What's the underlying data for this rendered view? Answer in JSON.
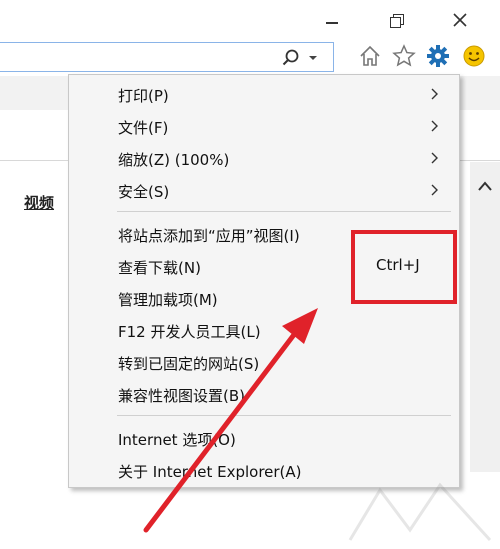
{
  "menu": {
    "items": [
      {
        "label": "打印(P)",
        "submenu": true
      },
      {
        "label": "文件(F)",
        "submenu": true
      },
      {
        "label": "缩放(Z) (100%)",
        "submenu": true
      },
      {
        "label": "安全(S)",
        "submenu": true
      },
      {
        "label": "将站点添加到“应用”视图(I)",
        "submenu": false
      },
      {
        "label": "查看下载(N)",
        "submenu": false,
        "shortcut": "Ctrl+J"
      },
      {
        "label": "管理加载项(M)",
        "submenu": false
      },
      {
        "label": "F12 开发人员工具(L)",
        "submenu": false
      },
      {
        "label": "转到已固定的网站(S)",
        "submenu": false
      },
      {
        "label": "兼容性视图设置(B)",
        "submenu": false
      },
      {
        "label": "Internet 选项(O)",
        "submenu": false
      },
      {
        "label": "关于 Internet Explorer(A)",
        "submenu": false
      }
    ]
  },
  "page": {
    "link_text": "视频"
  },
  "annotation": {
    "highlight_color": "#e0222a"
  },
  "toolbar": {
    "icons": [
      "search-icon",
      "chevron-down-icon",
      "home-icon",
      "star-icon",
      "gear-icon",
      "smiley-icon"
    ],
    "gear_color": "#1f6fb5",
    "smiley_color": "#f5c400"
  }
}
